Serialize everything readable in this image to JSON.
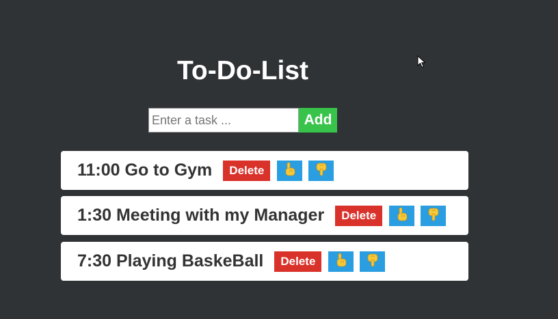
{
  "app": {
    "title": "To-Do-List"
  },
  "form": {
    "placeholder": "Enter a task ...",
    "value": "",
    "add_label": "Add"
  },
  "tasks": [
    {
      "text": "11:00 Go to Gym",
      "delete_label": "Delete",
      "up_icon": "pointing-up-hand-icon",
      "down_icon": "thumbs-down-icon"
    },
    {
      "text": "1:30 Meeting with my Manager",
      "delete_label": "Delete",
      "up_icon": "pointing-up-hand-icon",
      "down_icon": "thumbs-down-icon"
    },
    {
      "text": "7:30 Playing BaskeBall",
      "delete_label": "Delete",
      "up_icon": "pointing-up-hand-icon",
      "down_icon": "thumbs-down-icon"
    }
  ],
  "colors": {
    "background": "#303336",
    "add_button": "#38c44a",
    "delete_button": "#d9322b",
    "icon_button": "#2a9ee0",
    "card": "#ffffff",
    "text": "#333333"
  }
}
